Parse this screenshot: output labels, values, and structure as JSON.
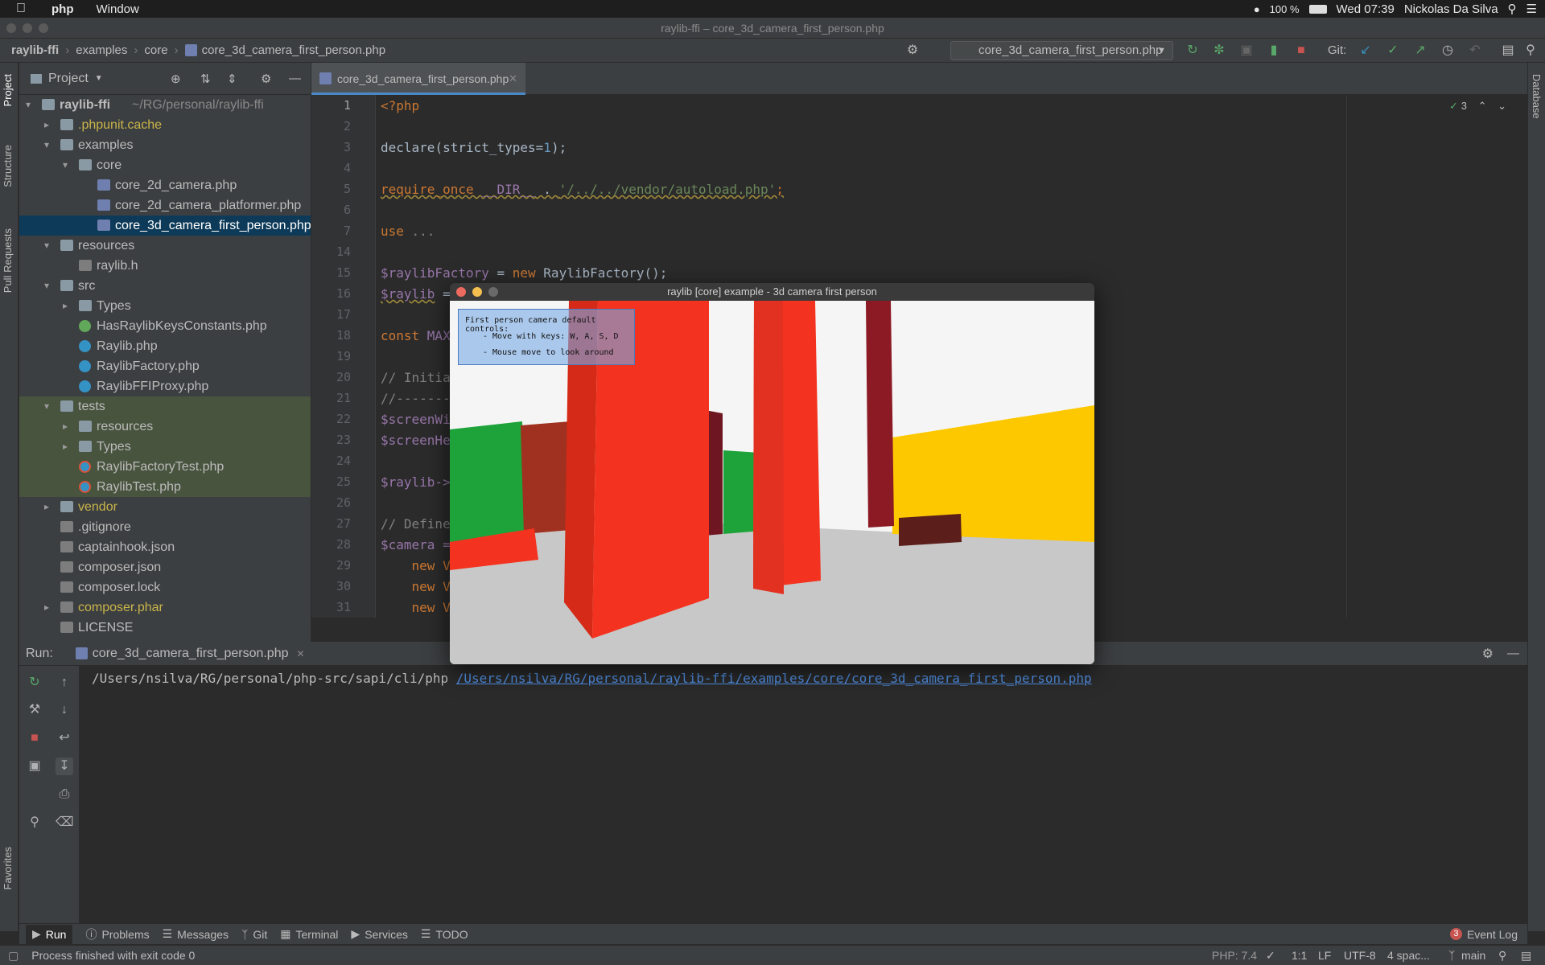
{
  "menubar": {
    "app": "php",
    "menu": [
      "Window"
    ],
    "status": {
      "battery": "100 %",
      "datetime": "Wed 07:39",
      "user": "Nickolas Da Silva"
    }
  },
  "window_title": "raylib-ffi – core_3d_camera_first_person.php",
  "breadcrumb": [
    "raylib-ffi",
    "examples",
    "core",
    "core_3d_camera_first_person.php"
  ],
  "run_config": "core_3d_camera_first_person.php",
  "git_label": "Git:",
  "left_strip": {
    "project": "Project",
    "structure": "Structure",
    "pull_requests": "Pull Requests",
    "favorites": "Favorites"
  },
  "right_strip": {
    "database": "Database"
  },
  "project_panel": {
    "title": "Project",
    "tree": [
      {
        "label": "raylib-ffi",
        "extra": "~/RG/personal/raylib-ffi",
        "depth": 0,
        "type": "folder",
        "open": true
      },
      {
        "label": ".phpunit.cache",
        "depth": 1,
        "type": "folder",
        "open": false,
        "color": "#c9b44a"
      },
      {
        "label": "examples",
        "depth": 1,
        "type": "folder",
        "open": true
      },
      {
        "label": "core",
        "depth": 2,
        "type": "folder",
        "open": true
      },
      {
        "label": "core_2d_camera.php",
        "depth": 3,
        "type": "php"
      },
      {
        "label": "core_2d_camera_platformer.php",
        "depth": 3,
        "type": "php"
      },
      {
        "label": "core_3d_camera_first_person.php",
        "depth": 3,
        "type": "php",
        "selected": true
      },
      {
        "label": "resources",
        "depth": 1,
        "type": "folder",
        "open": true
      },
      {
        "label": "raylib.h",
        "depth": 2,
        "type": "gen"
      },
      {
        "label": "src",
        "depth": 1,
        "type": "folder",
        "open": true
      },
      {
        "label": "Types",
        "depth": 2,
        "type": "folder",
        "open": false
      },
      {
        "label": "HasRaylibKeysConstants.php",
        "depth": 2,
        "type": "iface"
      },
      {
        "label": "Raylib.php",
        "depth": 2,
        "type": "class"
      },
      {
        "label": "RaylibFactory.php",
        "depth": 2,
        "type": "class"
      },
      {
        "label": "RaylibFFIProxy.php",
        "depth": 2,
        "type": "class"
      },
      {
        "label": "tests",
        "depth": 1,
        "type": "folder",
        "open": true,
        "test": true
      },
      {
        "label": "resources",
        "depth": 2,
        "type": "folder",
        "open": false,
        "test": true
      },
      {
        "label": "Types",
        "depth": 2,
        "type": "folder",
        "open": false,
        "test": true
      },
      {
        "label": "RaylibFactoryTest.php",
        "depth": 2,
        "type": "test",
        "test": true
      },
      {
        "label": "RaylibTest.php",
        "depth": 2,
        "type": "test",
        "test": true
      },
      {
        "label": "vendor",
        "depth": 1,
        "type": "folder",
        "open": false,
        "color": "#c9b44a"
      },
      {
        "label": ".gitignore",
        "depth": 1,
        "type": "gen"
      },
      {
        "label": "captainhook.json",
        "depth": 1,
        "type": "gen"
      },
      {
        "label": "composer.json",
        "depth": 1,
        "type": "gen"
      },
      {
        "label": "composer.lock",
        "depth": 1,
        "type": "gen"
      },
      {
        "label": "composer.phar",
        "depth": 1,
        "type": "gen",
        "open": false,
        "color": "#c9b44a",
        "collapsible": true
      },
      {
        "label": "LICENSE",
        "depth": 1,
        "type": "gen"
      }
    ]
  },
  "editor": {
    "tab": "core_3d_camera_first_person.php",
    "inspection_count": "3",
    "line_numbers": [
      "1",
      "2",
      "3",
      "4",
      "5",
      "6",
      "7",
      "14",
      "15",
      "16",
      "17",
      "18",
      "19",
      "20",
      "21",
      "22",
      "23",
      "24",
      "25",
      "26",
      "27",
      "28",
      "29",
      "30",
      "31"
    ],
    "lines": [
      [
        {
          "t": "<?php",
          "c": "kw"
        }
      ],
      [],
      [
        {
          "t": "declare",
          "c": "fn"
        },
        {
          "t": "(strict_types=",
          "c": "fn"
        },
        {
          "t": "1",
          "c": "num"
        },
        {
          "t": ");",
          "c": "fn"
        }
      ],
      [],
      [
        {
          "t": "require_once ",
          "c": "kw ul"
        },
        {
          "t": "__DIR__",
          "c": "var ul"
        },
        {
          "t": " . ",
          "c": "fn ul"
        },
        {
          "t": "'/../../vendor/autoload.php'",
          "c": "str ul"
        },
        {
          "t": ";",
          "c": "kw ul"
        }
      ],
      [],
      [
        {
          "t": "use ",
          "c": "kw"
        },
        {
          "t": "...",
          "c": "cmt"
        }
      ],
      [],
      [
        {
          "t": "$raylibFactory",
          "c": "var"
        },
        {
          "t": " = ",
          "c": "fn"
        },
        {
          "t": "new ",
          "c": "kw"
        },
        {
          "t": "RaylibFactory();",
          "c": "fn"
        }
      ],
      [
        {
          "t": "$raylib",
          "c": "var ul"
        },
        {
          "t": " =",
          "c": "fn"
        }
      ],
      [],
      [
        {
          "t": "const ",
          "c": "kw"
        },
        {
          "t": "MAX",
          "c": "var"
        }
      ],
      [],
      [
        {
          "t": "// Initia",
          "c": "cmt"
        }
      ],
      [
        {
          "t": "//-------",
          "c": "cmt"
        }
      ],
      [
        {
          "t": "$screenWi",
          "c": "var"
        }
      ],
      [
        {
          "t": "$screenHe",
          "c": "var"
        }
      ],
      [],
      [
        {
          "t": "$raylib->",
          "c": "var"
        },
        {
          "t": "                                                     first person\");",
          "c": "str"
        }
      ],
      [],
      [
        {
          "t": "// Define",
          "c": "cmt"
        }
      ],
      [
        {
          "t": "$camera =",
          "c": "var"
        }
      ],
      [
        {
          "t": "    new V",
          "c": "kw"
        }
      ],
      [
        {
          "t": "    new V",
          "c": "kw"
        }
      ],
      [
        {
          "t": "    new V",
          "c": "kw"
        }
      ]
    ]
  },
  "raylib_window": {
    "title": "raylib [core] example - 3d camera first person",
    "help_title": "First person camera default controls:",
    "help_lines": [
      "- Move with keys: W, A, S, D",
      "- Mouse move to look around"
    ]
  },
  "run_panel": {
    "label": "Run:",
    "tab": "core_3d_camera_first_person.php",
    "cmd": "/Users/nsilva/RG/personal/php-src/sapi/cli/php",
    "path": "/Users/nsilva/RG/personal/raylib-ffi/examples/core/core_3d_camera_first_person.php"
  },
  "bottom_tabs": [
    "Run",
    "Problems",
    "Messages",
    "Git",
    "Terminal",
    "Services",
    "TODO"
  ],
  "event_log": {
    "label": "Event Log",
    "count": "3"
  },
  "status": {
    "message": "Process finished with exit code 0",
    "php": "PHP: 7.4",
    "position": "1:1",
    "line_sep": "LF",
    "encoding": "UTF-8",
    "indent": "4 spac...",
    "branch": "main"
  }
}
